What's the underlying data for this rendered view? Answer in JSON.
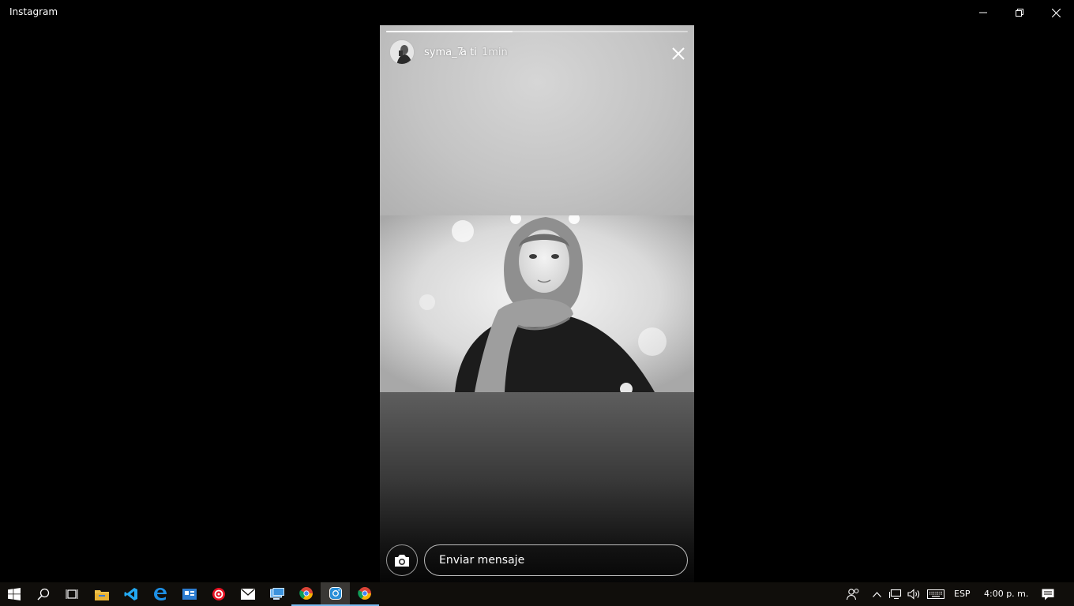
{
  "window": {
    "title": "Instagram"
  },
  "story": {
    "username": "syma_7",
    "audience": "a ti",
    "time_ago": "1min",
    "progress": 0.42,
    "message_placeholder": "Enviar mensaje"
  },
  "taskbar": {
    "apps": [
      {
        "name": "start",
        "icon": "windows-logo-icon"
      },
      {
        "name": "search",
        "icon": "search-icon"
      },
      {
        "name": "task-view",
        "icon": "task-view-icon"
      },
      {
        "name": "file-explorer",
        "icon": "folder-icon"
      },
      {
        "name": "vs-code",
        "icon": "vscode-icon"
      },
      {
        "name": "edge",
        "icon": "edge-icon"
      },
      {
        "name": "app-red",
        "icon": "red-circle-app-icon"
      },
      {
        "name": "mail",
        "icon": "mail-icon"
      },
      {
        "name": "remote-desktop",
        "icon": "monitor-icon"
      },
      {
        "name": "chrome",
        "icon": "chrome-icon"
      },
      {
        "name": "instagram",
        "icon": "instagram-icon"
      },
      {
        "name": "chrome-2",
        "icon": "chrome-icon"
      }
    ],
    "language": "ESP",
    "clock": "4:00 p. m."
  },
  "colors": {
    "taskbar_bg": "#100e0b",
    "accent": "#76b9ed",
    "window_bg": "#000000"
  }
}
